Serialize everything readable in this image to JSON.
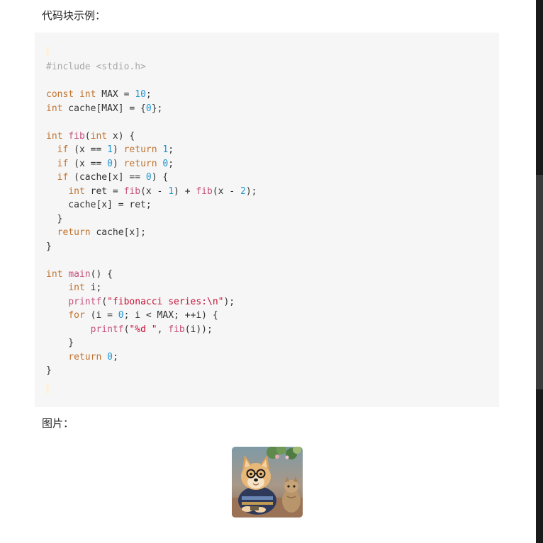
{
  "labels": {
    "code_example": "代码块示例：",
    "image": "图片："
  },
  "code": {
    "language": "c",
    "lines": [
      [
        [
          "pre",
          "#include <stdio.h>"
        ]
      ],
      [],
      [
        [
          "kw",
          "const"
        ],
        [
          "txt",
          " "
        ],
        [
          "kw",
          "int"
        ],
        [
          "txt",
          " MAX = "
        ],
        [
          "num",
          "10"
        ],
        [
          "txt",
          ";"
        ]
      ],
      [
        [
          "kw",
          "int"
        ],
        [
          "txt",
          " cache[MAX] = {"
        ],
        [
          "num",
          "0"
        ],
        [
          "txt",
          "};"
        ]
      ],
      [],
      [
        [
          "kw",
          "int"
        ],
        [
          "txt",
          " "
        ],
        [
          "fn",
          "fib"
        ],
        [
          "txt",
          "("
        ],
        [
          "kw",
          "int"
        ],
        [
          "txt",
          " x) {"
        ]
      ],
      [
        [
          "txt",
          "  "
        ],
        [
          "kw",
          "if"
        ],
        [
          "txt",
          " (x == "
        ],
        [
          "num",
          "1"
        ],
        [
          "txt",
          ") "
        ],
        [
          "kw",
          "return"
        ],
        [
          "txt",
          " "
        ],
        [
          "num",
          "1"
        ],
        [
          "txt",
          ";"
        ]
      ],
      [
        [
          "txt",
          "  "
        ],
        [
          "kw",
          "if"
        ],
        [
          "txt",
          " (x == "
        ],
        [
          "num",
          "0"
        ],
        [
          "txt",
          ") "
        ],
        [
          "kw",
          "return"
        ],
        [
          "txt",
          " "
        ],
        [
          "num",
          "0"
        ],
        [
          "txt",
          ";"
        ]
      ],
      [
        [
          "txt",
          "  "
        ],
        [
          "kw",
          "if"
        ],
        [
          "txt",
          " (cache[x] == "
        ],
        [
          "num",
          "0"
        ],
        [
          "txt",
          ") {"
        ]
      ],
      [
        [
          "txt",
          "    "
        ],
        [
          "kw",
          "int"
        ],
        [
          "txt",
          " ret = "
        ],
        [
          "fn",
          "fib"
        ],
        [
          "txt",
          "(x - "
        ],
        [
          "num",
          "1"
        ],
        [
          "txt",
          ") + "
        ],
        [
          "fn",
          "fib"
        ],
        [
          "txt",
          "(x - "
        ],
        [
          "num",
          "2"
        ],
        [
          "txt",
          ");"
        ]
      ],
      [
        [
          "txt",
          "    cache[x] = ret;"
        ]
      ],
      [
        [
          "txt",
          "  }"
        ]
      ],
      [
        [
          "txt",
          "  "
        ],
        [
          "kw",
          "return"
        ],
        [
          "txt",
          " cache[x];"
        ]
      ],
      [
        [
          "txt",
          "}"
        ]
      ],
      [],
      [
        [
          "kw",
          "int"
        ],
        [
          "txt",
          " "
        ],
        [
          "fn",
          "main"
        ],
        [
          "txt",
          "() {"
        ]
      ],
      [
        [
          "txt",
          "    "
        ],
        [
          "kw",
          "int"
        ],
        [
          "txt",
          " i;"
        ]
      ],
      [
        [
          "txt",
          "    "
        ],
        [
          "fn",
          "printf"
        ],
        [
          "txt",
          "("
        ],
        [
          "str",
          "\"fibonacci series:\\n\""
        ],
        [
          "txt",
          ");"
        ]
      ],
      [
        [
          "txt",
          "    "
        ],
        [
          "kw",
          "for"
        ],
        [
          "txt",
          " (i = "
        ],
        [
          "num",
          "0"
        ],
        [
          "txt",
          "; i < MAX; ++i) {"
        ]
      ],
      [
        [
          "txt",
          "        "
        ],
        [
          "fn",
          "printf"
        ],
        [
          "txt",
          "("
        ],
        [
          "str",
          "\"%d \""
        ],
        [
          "txt",
          ", "
        ],
        [
          "fn",
          "fib"
        ],
        [
          "txt",
          "(i));"
        ]
      ],
      [
        [
          "txt",
          "    }"
        ]
      ],
      [
        [
          "txt",
          "    "
        ],
        [
          "kw",
          "return"
        ],
        [
          "txt",
          " "
        ],
        [
          "num",
          "0"
        ],
        [
          "txt",
          ";"
        ]
      ],
      [
        [
          "txt",
          "}"
        ]
      ]
    ]
  },
  "image": {
    "subject": "dog-and-cat-photo"
  },
  "colors": {
    "code_background": "#f6f6f6",
    "keyword": "#c0722e",
    "number": "#1f96d3",
    "function": "#c6527d",
    "string": "#c4143a",
    "preprocessor": "#a8a8a8"
  }
}
